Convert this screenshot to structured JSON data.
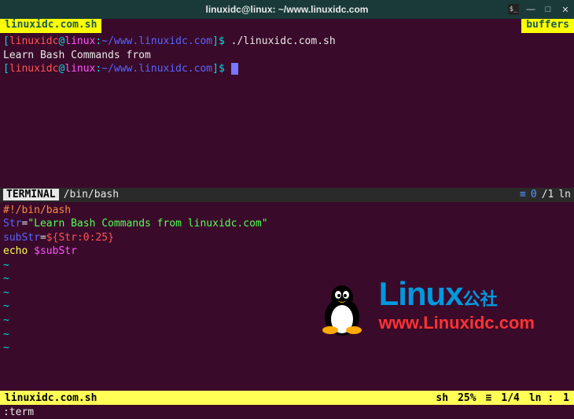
{
  "titlebar": {
    "title": "linuxidc@linux: ~/www.linuxidc.com"
  },
  "tab": {
    "file": "linuxidc.com.sh",
    "buffers": "buffers"
  },
  "terminal": {
    "prompt_open": "[",
    "user": "linuxidc",
    "at": "@",
    "host": "linux",
    "colon": ":",
    "path": "~/www.linuxidc.com",
    "prompt_close": "]$",
    "cmd1": "./linuxidc.com.sh",
    "output1": "Learn Bash Commands from"
  },
  "split": {
    "mode": "TERMINAL",
    "shell": "/bin/bash",
    "menu": "≡",
    "pos": "0",
    "sep": "/1",
    "ln": "ln"
  },
  "editor": {
    "line1_shebang": "#!/bin/bash",
    "line2_var": "Str",
    "line2_eq": "=",
    "line2_str": "\"Learn Bash Commands from linuxidc.com\"",
    "line3_var": "subStr",
    "line3_eq": "=",
    "line3_exp": "${Str:0:25}",
    "line4_cmd": "echo",
    "line4_arg": "$subStr",
    "tilde": "~"
  },
  "status": {
    "file": "linuxidc.com.sh",
    "filetype": "sh",
    "percent": "25%",
    "sep": "≡",
    "pos": "1/4",
    "ln": "ln :",
    "col": "1"
  },
  "cmdline": {
    "cmd": ":term"
  },
  "watermark": {
    "brand": "Linux",
    "cn": "公社",
    "url": "www.Linuxidc.com"
  }
}
